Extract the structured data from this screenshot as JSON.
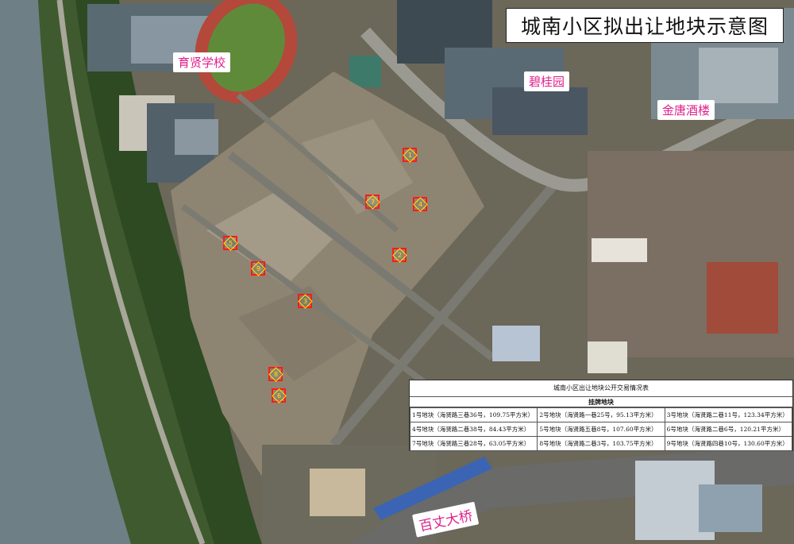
{
  "title": "城南小区拟出让地块示意图",
  "pois": {
    "school": "育贤学校",
    "bigui": "碧桂园",
    "jintang": "金唐酒楼",
    "bridge": "百丈大桥"
  },
  "plots": [
    "1",
    "2",
    "3",
    "4",
    "5",
    "6",
    "7",
    "8",
    "9"
  ],
  "table": {
    "title": "城南小区出让地块公开交易情况表",
    "subtitle": "挂牌地块",
    "rows": [
      [
        "1号地块（海贤路三巷36号，109.75平方米）",
        "2号地块（海贤路一巷25号，95.13平方米）",
        "3号地块（海贤路二巷11号，123.34平方米）"
      ],
      [
        "4号地块（海贤路二巷38号，84.43平方米）",
        "5号地块（海贤路五巷8号，107.60平方米）",
        "6号地块（海贤路二巷6号，120.21平方米）"
      ],
      [
        "7号地块（海贤路三巷28号，63.05平方米）",
        "8号地块（海贤路二巷3号，103.75平方米）",
        "9号地块（海贤路四巷10号，130.60平方米）"
      ]
    ]
  },
  "colors": {
    "marker": "#ff1a1a",
    "marker_inner": "#ffe600",
    "poi_text": "#e0218a"
  }
}
